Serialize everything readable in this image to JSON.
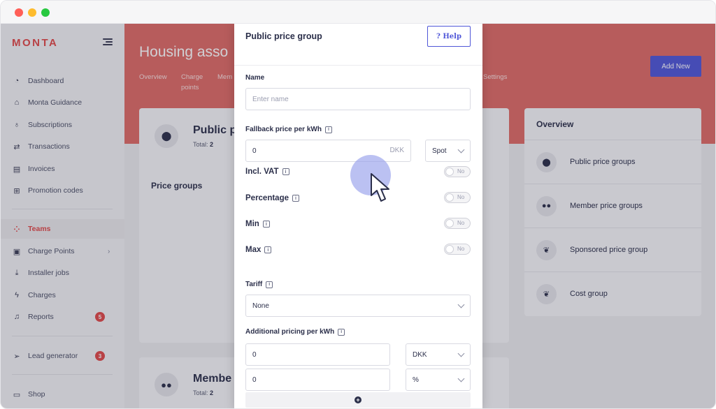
{
  "sidebar": {
    "logo": "MONTA",
    "items": [
      {
        "label": "Dashboard",
        "icon": "dashboard-icon",
        "glyph": "◔"
      },
      {
        "label": "Monta Guidance",
        "icon": "home-icon",
        "glyph": "⌂"
      },
      {
        "label": "Subscriptions",
        "icon": "lightbulb-icon",
        "glyph": "♁"
      },
      {
        "label": "Transactions",
        "icon": "transfer-icon",
        "glyph": "⇄"
      },
      {
        "label": "Invoices",
        "icon": "invoice-icon",
        "glyph": "▤"
      },
      {
        "label": "Promotion codes",
        "icon": "gift-icon",
        "glyph": "⊞"
      },
      {
        "label": "Teams",
        "icon": "grid-icon",
        "glyph": "⁘"
      },
      {
        "label": "Charge Points",
        "icon": "charge-point-icon",
        "glyph": "▣"
      },
      {
        "label": "Installer jobs",
        "icon": "download-box-icon",
        "glyph": "⤓"
      },
      {
        "label": "Charges",
        "icon": "bolt-icon",
        "glyph": "ϟ"
      },
      {
        "label": "Reports",
        "icon": "bell-icon",
        "glyph": "♫",
        "badge": "5"
      },
      {
        "label": "Lead generator",
        "icon": "send-icon",
        "glyph": "➢",
        "badge": "3"
      },
      {
        "label": "Shop",
        "icon": "shop-icon",
        "glyph": "▭"
      }
    ]
  },
  "header": {
    "title": "Housing asso",
    "tabs": [
      "Overview",
      "Charge points",
      "Mem",
      "Settings"
    ],
    "add_new_label": "Add New"
  },
  "cards": {
    "public": {
      "title": "Public p",
      "total_label": "Total:",
      "total_value": "2",
      "icon": "location-pin-icon"
    },
    "price_groups_label": "Price groups",
    "member": {
      "title": "Membe",
      "total_label": "Total:",
      "total_value": "2",
      "icon": "people-icon"
    }
  },
  "overview": {
    "title": "Overview",
    "items": [
      {
        "label": "Public price groups",
        "icon": "location-pin-icon",
        "glyph": "⬤"
      },
      {
        "label": "Member price groups",
        "icon": "people-icon",
        "glyph": "👥"
      },
      {
        "label": "Sponsored price group",
        "icon": "hand-heart-icon",
        "glyph": "❦"
      },
      {
        "label": "Cost group",
        "icon": "hand-heart-icon",
        "glyph": "❦"
      }
    ]
  },
  "modal": {
    "title": "Public price group",
    "help_label": "? Help",
    "name_label": "Name",
    "name_placeholder": "Enter name",
    "fallback_label": "Fallback price per kWh",
    "fallback_value": "0",
    "fallback_currency": "DKK",
    "fallback_type": "Spot",
    "toggles": [
      {
        "label": "Incl. VAT",
        "state": "No"
      },
      {
        "label": "Percentage",
        "state": "No"
      },
      {
        "label": "Min",
        "state": "No"
      },
      {
        "label": "Max",
        "state": "No"
      }
    ],
    "tariff_label": "Tariff",
    "tariff_value": "None",
    "additional_label": "Additional pricing per kWh",
    "additional_rows": [
      {
        "value": "0",
        "unit": "DKK"
      },
      {
        "value": "0",
        "unit": "%"
      }
    ],
    "info_glyph": "i",
    "plus_glyph": "+"
  },
  "colors": {
    "brand_red": "#e04848",
    "hero": "#df6b66",
    "accent": "#4f56d8"
  }
}
